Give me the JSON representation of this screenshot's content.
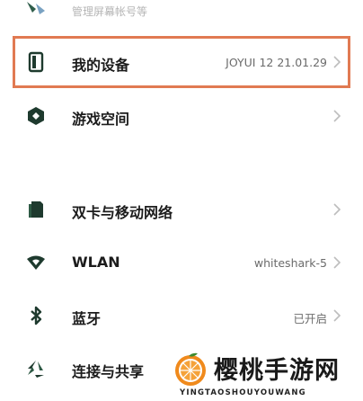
{
  "top_item": {
    "label": "管理屏幕帐号等"
  },
  "settings": {
    "my_device": {
      "label": "我的设备",
      "value": "JOYUI 12 21.01.29"
    },
    "game_space": {
      "label": "游戏空间"
    },
    "dual_sim": {
      "label": "双卡与移动网络"
    },
    "wlan": {
      "label": "WLAN",
      "value": "whiteshark-5"
    },
    "bluetooth": {
      "label": "蓝牙",
      "value": "已开启"
    },
    "connection_share": {
      "label": "连接与共享"
    }
  },
  "watermark": {
    "title": "樱桃手游网",
    "subtitle": "YINGTAOSHOUYOUWANG"
  },
  "colors": {
    "highlight": "#e17a52",
    "icon_green": "#1e3a2e",
    "watermark_orange": "#f08a1c"
  }
}
